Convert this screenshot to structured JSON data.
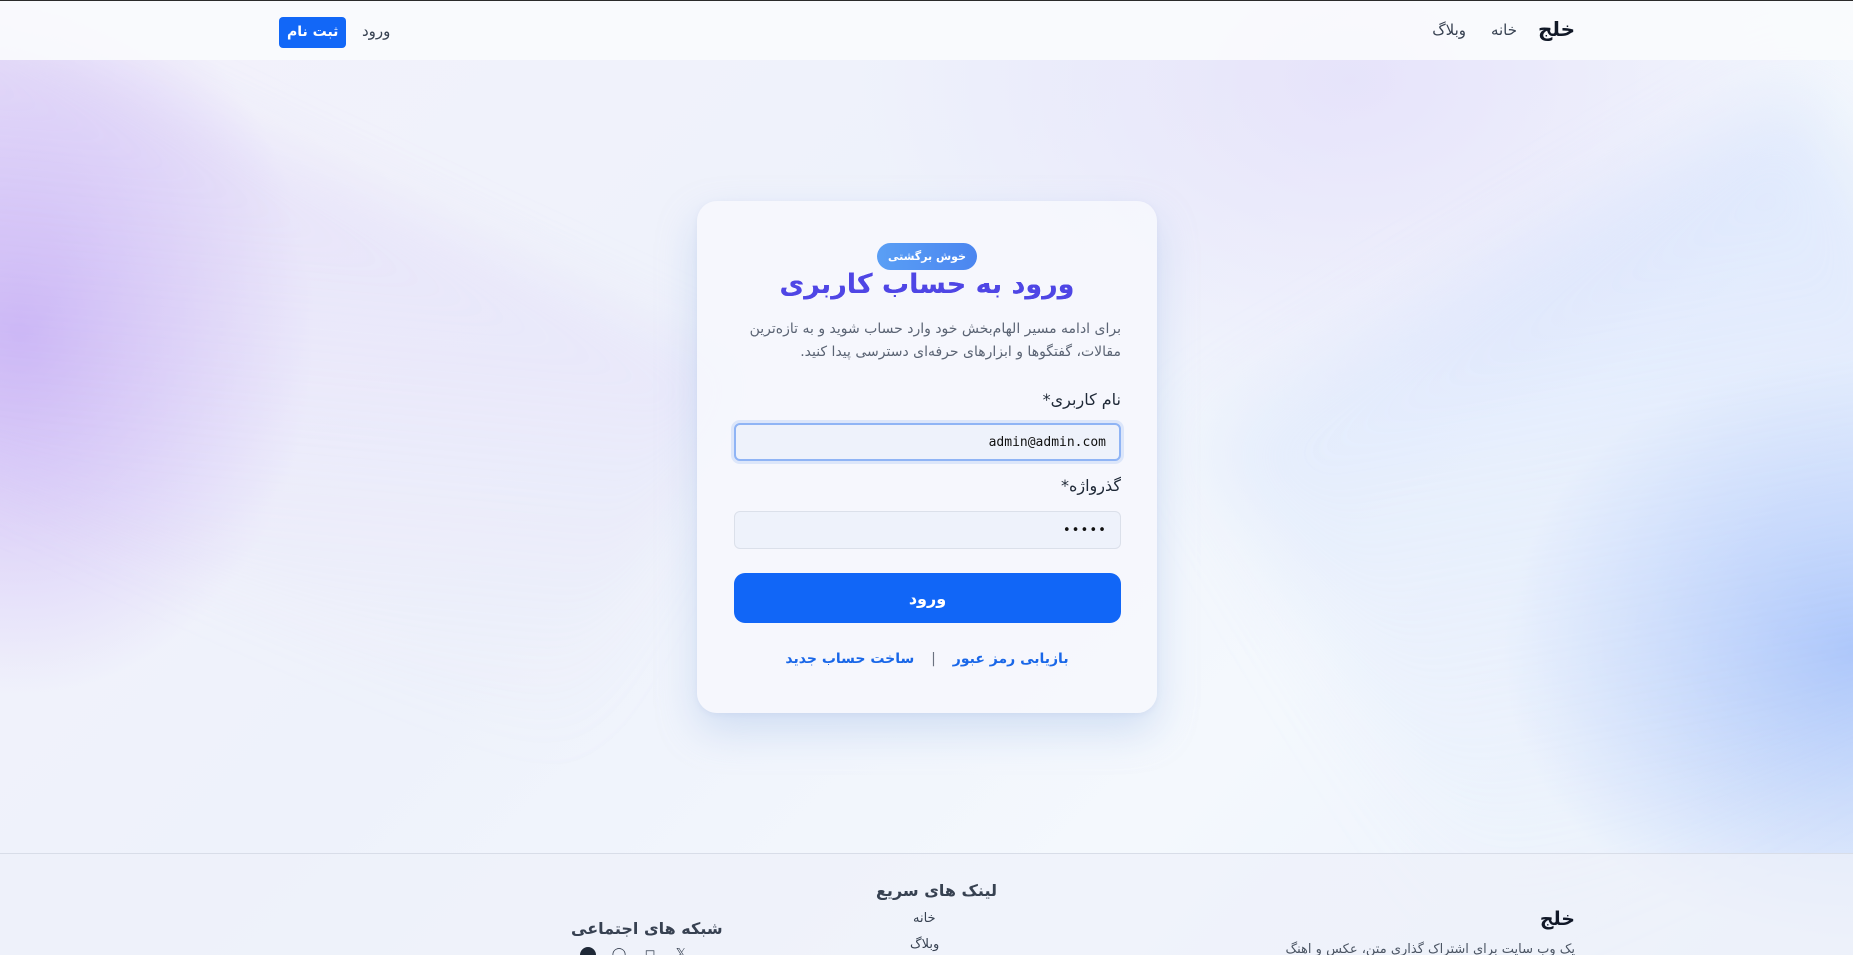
{
  "header": {
    "brand": "خلج",
    "nav": {
      "home": "خانه",
      "blog": "وبلاگ",
      "login": "ورود"
    },
    "signup_label": "ثبت نام"
  },
  "login_card": {
    "badge": "خوش برگشتی",
    "title": "ورود به حساب کاربری",
    "description": "برای ادامه مسیر الهام‌بخش خود وارد حساب شوید و به تازه‌ترین مقالات، گفتگوها و ابزارهای حرفه‌ای دسترسی پیدا کنید.",
    "username_label": "نام کاربری*",
    "username_value": "admin@admin.com",
    "password_label": "گذرواژه*",
    "password_value": "•••••",
    "submit_label": "ورود",
    "forgot_label": "بازیابی رمز عبور",
    "separator": "|",
    "register_label": "ساخت حساب جدید"
  },
  "footer": {
    "brand": "خلج",
    "tagline": "یک وب سایت برای اشتراک گذاری متن، عکس و اهنگ",
    "quick_links_title": "لینک های سریع",
    "quick_links": {
      "home": "خانه",
      "blog": "وبلاگ"
    },
    "social_title": "شبکه های اجتماعی",
    "social_icons": [
      "x-icon",
      "instagram-icon",
      "whatsapp-icon",
      "github-icon"
    ]
  },
  "colors": {
    "primary": "#1267f7",
    "title_gradient_start": "#6d3ee6",
    "title_gradient_end": "#3d5fe8",
    "badge": "#4b86f0"
  }
}
